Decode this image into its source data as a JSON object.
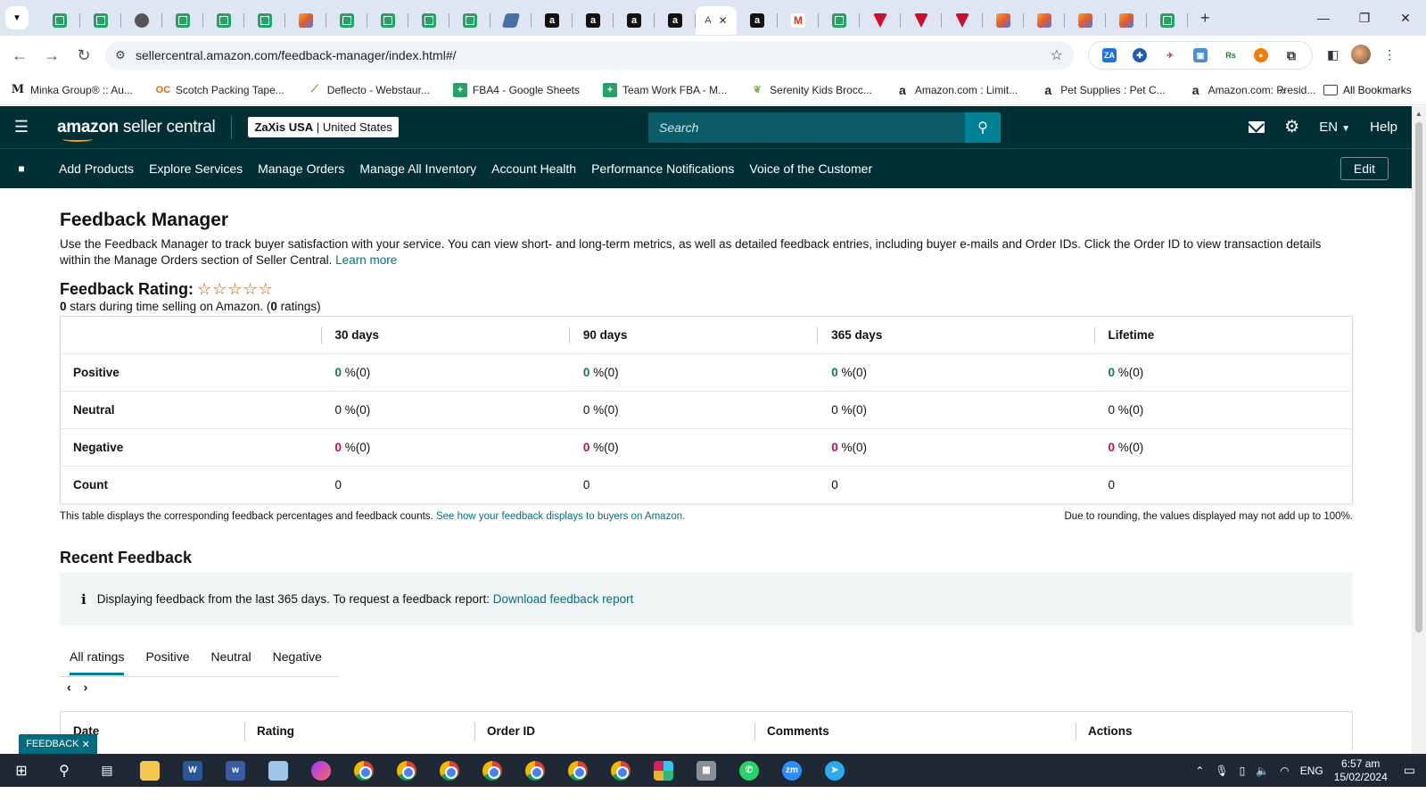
{
  "browser": {
    "url": "sellercentral.amazon.com/feedback-manager/index.html#/",
    "active_tab_label": "A",
    "bookmarks": [
      {
        "label": "Minka Group® :: Au...",
        "icon": "M"
      },
      {
        "label": "Scotch Packing Tape...",
        "icon": "OC"
      },
      {
        "label": "Deflecto - Webstaur...",
        "icon": "D"
      },
      {
        "label": "FBA4 - Google Sheets",
        "icon": "sheets"
      },
      {
        "label": "Team Work FBA - M...",
        "icon": "sheets"
      },
      {
        "label": "Serenity Kids Brocc...",
        "icon": "leaf"
      },
      {
        "label": "Amazon.com : Limit...",
        "icon": "a"
      },
      {
        "label": "Pet Supplies : Pet C...",
        "icon": "a"
      },
      {
        "label": "Amazon.com: Presid...",
        "icon": "a"
      }
    ],
    "all_bookmarks_label": "All Bookmarks"
  },
  "header": {
    "logo_text_bold": "amazon",
    "logo_text": " seller central",
    "store_name": "ZaXis USA",
    "store_region": "United States",
    "search_placeholder": "Search",
    "language": "EN",
    "help_label": "Help"
  },
  "nav": {
    "links": [
      "Add Products",
      "Explore Services",
      "Manage Orders",
      "Manage All Inventory",
      "Account Health",
      "Performance Notifications",
      "Voice of the Customer"
    ],
    "edit_label": "Edit"
  },
  "page": {
    "title": "Feedback Manager",
    "intro": "Use the Feedback Manager to track buyer satisfaction with your service. You can view short- and long-term metrics, as well as detailed feedback entries, including buyer e-mails and Order IDs. Click the Order ID to view transaction details within the Manage Orders section of Seller Central.",
    "learn_more": "Learn more",
    "rating_label": "Feedback Rating:",
    "rating_stars": 0,
    "rating_sub_stars": "0",
    "rating_sub_mid": " stars during time selling on Amazon. (",
    "rating_sub_count": "0",
    "rating_sub_end": " ratings)"
  },
  "metrics_table": {
    "columns": [
      "30 days",
      "90 days",
      "365 days",
      "Lifetime"
    ],
    "rows": [
      {
        "label": "Positive",
        "cells": [
          {
            "n": "0",
            "p": " %(0)"
          },
          {
            "n": "0",
            "p": " %(0)"
          },
          {
            "n": "0",
            "p": " %(0)"
          },
          {
            "n": "0",
            "p": " %(0)"
          }
        ]
      },
      {
        "label": "Neutral",
        "cells": [
          {
            "n": "0",
            "p": " %(0)"
          },
          {
            "n": "0",
            "p": " %(0)"
          },
          {
            "n": "0",
            "p": " %(0)"
          },
          {
            "n": "0",
            "p": " %(0)"
          }
        ]
      },
      {
        "label": "Negative",
        "cells": [
          {
            "n": "0",
            "p": " %(0)"
          },
          {
            "n": "0",
            "p": " %(0)"
          },
          {
            "n": "0",
            "p": " %(0)"
          },
          {
            "n": "0",
            "p": " %(0)"
          }
        ]
      },
      {
        "label": "Count",
        "cells": [
          {
            "n": "0",
            "p": ""
          },
          {
            "n": "0",
            "p": ""
          },
          {
            "n": "0",
            "p": ""
          },
          {
            "n": "0",
            "p": ""
          }
        ]
      }
    ],
    "note_left": "This table displays the corresponding feedback percentages and feedback counts.",
    "note_link": "See how your feedback displays to buyers on Amazon.",
    "note_right": "Due to rounding, the values displayed may not add up to 100%."
  },
  "recent": {
    "title": "Recent Feedback",
    "info_text": "Displaying feedback from the last 365 days. To request a feedback report:",
    "info_link": "Download feedback report",
    "tabs": [
      "All ratings",
      "Positive",
      "Neutral",
      "Negative"
    ],
    "columns": [
      "Date",
      "Rating",
      "Order ID",
      "Comments",
      "Actions"
    ]
  },
  "feedback_tab_label": "FEEDBACK",
  "taskbar": {
    "language": "ENG",
    "time": "6:57 am",
    "date": "15/02/2024"
  },
  "colors": {
    "header_bg": "#002f36",
    "accent": "#008296",
    "link": "#007185",
    "positive": "#067d62",
    "negative": "#cc0c39"
  }
}
